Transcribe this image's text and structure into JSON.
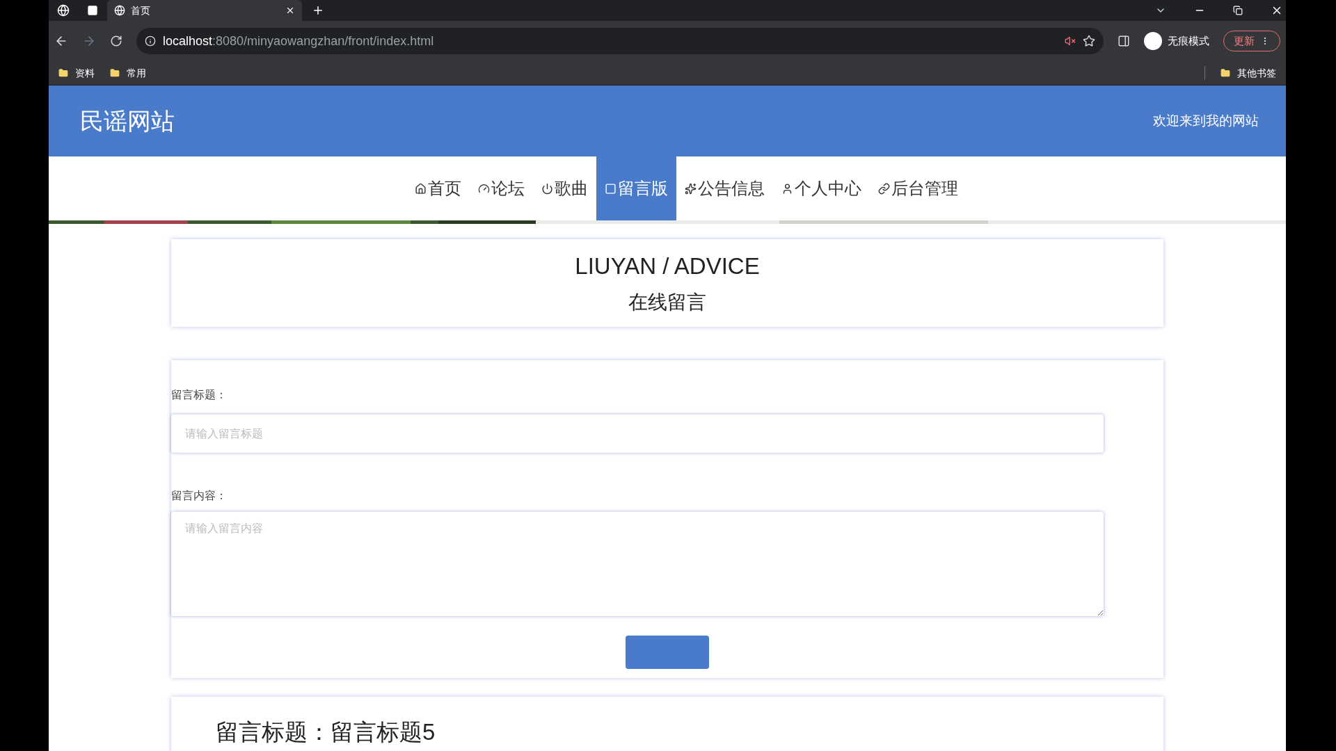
{
  "browser": {
    "tab_title": "首页",
    "url_host": "localhost",
    "url_rest": ":8080/minyaowangzhan/front/index.html",
    "incognito_label": "无痕模式",
    "update_button": "更新",
    "bookmarks": [
      "资料",
      "常用"
    ],
    "other_bookmarks": "其他书签"
  },
  "header": {
    "site_title": "民谣网站",
    "welcome": "欢迎来到我的网站"
  },
  "nav": [
    {
      "label": "首页",
      "kind": "home",
      "selected": false
    },
    {
      "label": "论坛",
      "kind": "forum",
      "selected": false
    },
    {
      "label": "歌曲",
      "kind": "song",
      "selected": false
    },
    {
      "label": "留言版",
      "kind": "message",
      "selected": true
    },
    {
      "label": "公告信息",
      "kind": "notice",
      "selected": false
    },
    {
      "label": "个人中心",
      "kind": "user",
      "selected": false
    },
    {
      "label": "后台管理",
      "kind": "admin",
      "selected": false
    }
  ],
  "section": {
    "title": "LIUYAN / ADVICE",
    "subtitle": "在线留言"
  },
  "form": {
    "title_label": "留言标题：",
    "title_placeholder": "请输入留言标题",
    "content_label": "留言内容：",
    "content_placeholder": "请输入留言内容"
  },
  "messages": [
    {
      "title": "留言标题：留言标题5"
    }
  ]
}
